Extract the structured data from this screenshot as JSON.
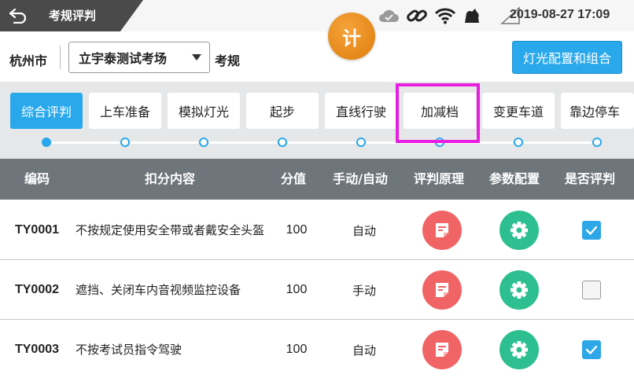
{
  "status_bar": {
    "title": "考规评判",
    "datetime": "2019-08-27 17:09"
  },
  "badge": {
    "label": "计"
  },
  "location": {
    "city": "杭州市",
    "exam_site": "立宇泰测试考场",
    "mode_label": "考规",
    "light_config_button": "灯光配置和组合"
  },
  "tabs": [
    {
      "label": "综合评判",
      "active": true
    },
    {
      "label": "上车准备",
      "active": false
    },
    {
      "label": "模拟灯光",
      "active": false
    },
    {
      "label": "起步",
      "active": false
    },
    {
      "label": "直线行驶",
      "active": false
    },
    {
      "label": "加减档",
      "active": false
    },
    {
      "label": "变更车道",
      "active": false
    },
    {
      "label": "靠边停车",
      "active": false
    }
  ],
  "table": {
    "headers": [
      "编码",
      "扣分内容",
      "分值",
      "手动/自动",
      "评判原理",
      "参数配置",
      "是否评判"
    ],
    "rows": [
      {
        "code": "TY0001",
        "content": "不按规定使用安全带或者戴安全头盔",
        "score": "100",
        "mode": "自动",
        "judged": true
      },
      {
        "code": "TY0002",
        "content": "遮挡、关闭车内音视频监控设备",
        "score": "100",
        "mode": "手动",
        "judged": false
      },
      {
        "code": "TY0003",
        "content": "不按考试员指令驾驶",
        "score": "100",
        "mode": "自动",
        "judged": true
      }
    ]
  },
  "colors": {
    "accent": "#29a8ec",
    "highlight": "#e81ee0",
    "rule_button": "#f16466",
    "param_button": "#2ebf91",
    "header_bg": "#6e767c"
  }
}
